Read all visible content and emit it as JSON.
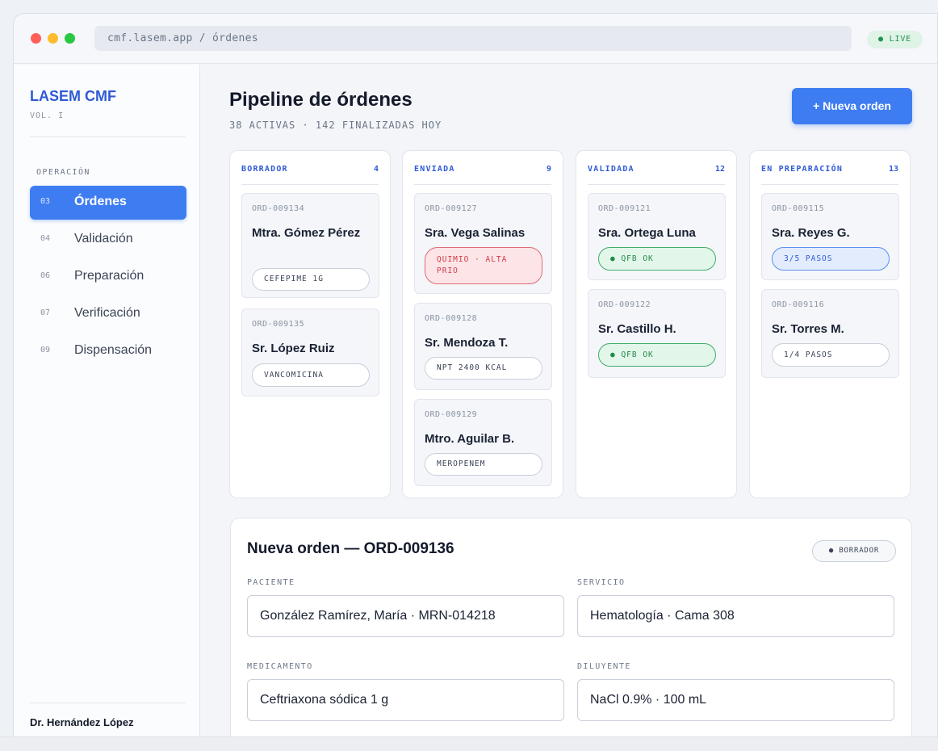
{
  "browser": {
    "url": "cmf.lasem.app / órdenes",
    "live_label": "● LIVE",
    "traffic_lights": {
      "red": "#ff5f57",
      "yellow": "#febc2e",
      "green": "#28c840"
    }
  },
  "sidebar": {
    "brand": "LASEM CMF",
    "volume": "VOL. I",
    "section": "OPERACIÓN",
    "items": [
      {
        "num": "03",
        "label": "Órdenes",
        "active": true
      },
      {
        "num": "04",
        "label": "Validación",
        "active": false
      },
      {
        "num": "06",
        "label": "Preparación",
        "active": false
      },
      {
        "num": "07",
        "label": "Verificación",
        "active": false
      },
      {
        "num": "09",
        "label": "Dispensación",
        "active": false
      }
    ],
    "user": "Dr. Hernández López"
  },
  "header": {
    "title": "Pipeline de órdenes",
    "subtitle": "38 ACTIVAS · 142 FINALIZADAS HOY",
    "new_button": "+ Nueva orden"
  },
  "columns": [
    {
      "title": "BORRADOR",
      "count": "4",
      "cards": [
        {
          "id": "ORD-009134",
          "name": "Mtra. Gómez Pérez",
          "tag": "CEFEPIME 1G",
          "tag_style": "neutral"
        },
        {
          "id": "ORD-009135",
          "name": "Sr. López Ruiz",
          "tag": "VANCOMICINA",
          "tag_style": "neutral"
        }
      ]
    },
    {
      "title": "ENVIADA",
      "count": "9",
      "cards": [
        {
          "id": "ORD-009127",
          "name": "Sra. Vega Salinas",
          "tag": "QUIMIO · ALTA PRIO",
          "tag_style": "red"
        },
        {
          "id": "ORD-009128",
          "name": "Sr. Mendoza T.",
          "tag": "NPT 2400 KCAL",
          "tag_style": "neutral"
        },
        {
          "id": "ORD-009129",
          "name": "Mtro. Aguilar B.",
          "tag": "MEROPENEM",
          "tag_style": "neutral"
        }
      ]
    },
    {
      "title": "VALIDADA",
      "count": "12",
      "cards": [
        {
          "id": "ORD-009121",
          "name": "Sra. Ortega Luna",
          "tag": "● QFB OK",
          "tag_style": "green"
        },
        {
          "id": "ORD-009122",
          "name": "Sr. Castillo H.",
          "tag": "● QFB OK",
          "tag_style": "green"
        }
      ]
    },
    {
      "title": "EN PREPARACIÓN",
      "count": "13",
      "cards": [
        {
          "id": "ORD-009115",
          "name": "Sra. Reyes G.",
          "tag": "3/5 PASOS",
          "tag_style": "blue"
        },
        {
          "id": "ORD-009116",
          "name": "Sr. Torres M.",
          "tag": "1/4 PASOS",
          "tag_style": "neutral"
        }
      ]
    }
  ],
  "form": {
    "title": "Nueva orden — ORD-009136",
    "status_badge": "● BORRADOR",
    "fields": {
      "paciente": {
        "label": "PACIENTE",
        "value": "González Ramírez, María · MRN-014218"
      },
      "servicio": {
        "label": "SERVICIO",
        "value": "Hematología · Cama 308"
      },
      "medicamento": {
        "label": "MEDICAMENTO",
        "value": "Ceftriaxona sódica 1 g"
      },
      "diluyente": {
        "label": "DILUYENTE",
        "value": "NaCl 0.9% · 100 mL"
      }
    }
  },
  "colors": {
    "accent": "#3e7df1",
    "brand": "#2f5ad6",
    "danger": "#d23b4c",
    "success": "#228a4a"
  }
}
